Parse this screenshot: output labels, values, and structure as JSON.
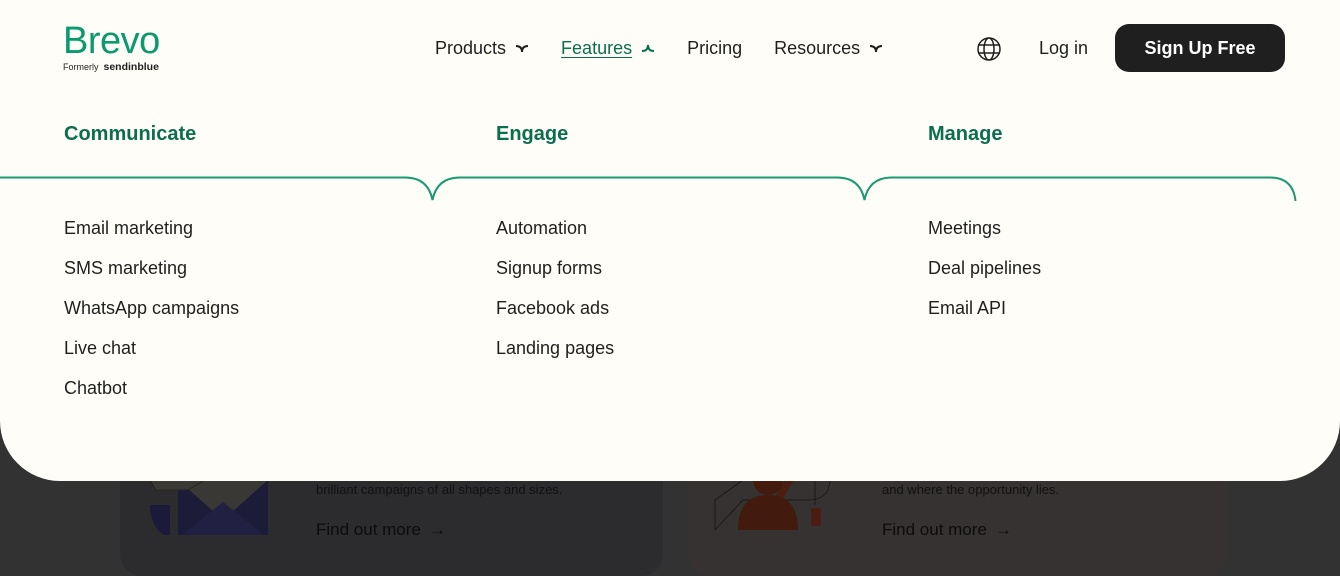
{
  "brand": {
    "name": "Brevo",
    "formerly_label": "Formerly",
    "formerly_name": "sendinblue",
    "color": "#0b996e"
  },
  "nav": {
    "items": [
      {
        "label": "Products",
        "has_dropdown": true,
        "expanded": false
      },
      {
        "label": "Features",
        "has_dropdown": true,
        "expanded": true
      },
      {
        "label": "Pricing",
        "has_dropdown": false
      },
      {
        "label": "Resources",
        "has_dropdown": true,
        "expanded": false
      }
    ],
    "language_icon": "globe-icon",
    "login_label": "Log in",
    "signup_label": "Sign Up Free"
  },
  "menu": {
    "accent_color": "#0b6e4f",
    "columns": [
      {
        "title": "Communicate",
        "items": [
          "Email marketing",
          "SMS marketing",
          "WhatsApp campaigns",
          "Live chat",
          "Chatbot"
        ]
      },
      {
        "title": "Engage",
        "items": [
          "Automation",
          "Signup forms",
          "Facebook ads",
          "Landing pages"
        ]
      },
      {
        "title": "Manage",
        "items": [
          "Meetings",
          "Deal pipelines",
          "Email API"
        ]
      }
    ]
  },
  "background": {
    "cards": [
      {
        "description": "brilliant campaigns of all shapes and sizes.",
        "link_label": "Find out more",
        "link_icon": "arrow-right-icon"
      },
      {
        "description": "and where the opportunity lies.",
        "link_label": "Find out more",
        "link_icon": "arrow-right-icon"
      }
    ]
  }
}
